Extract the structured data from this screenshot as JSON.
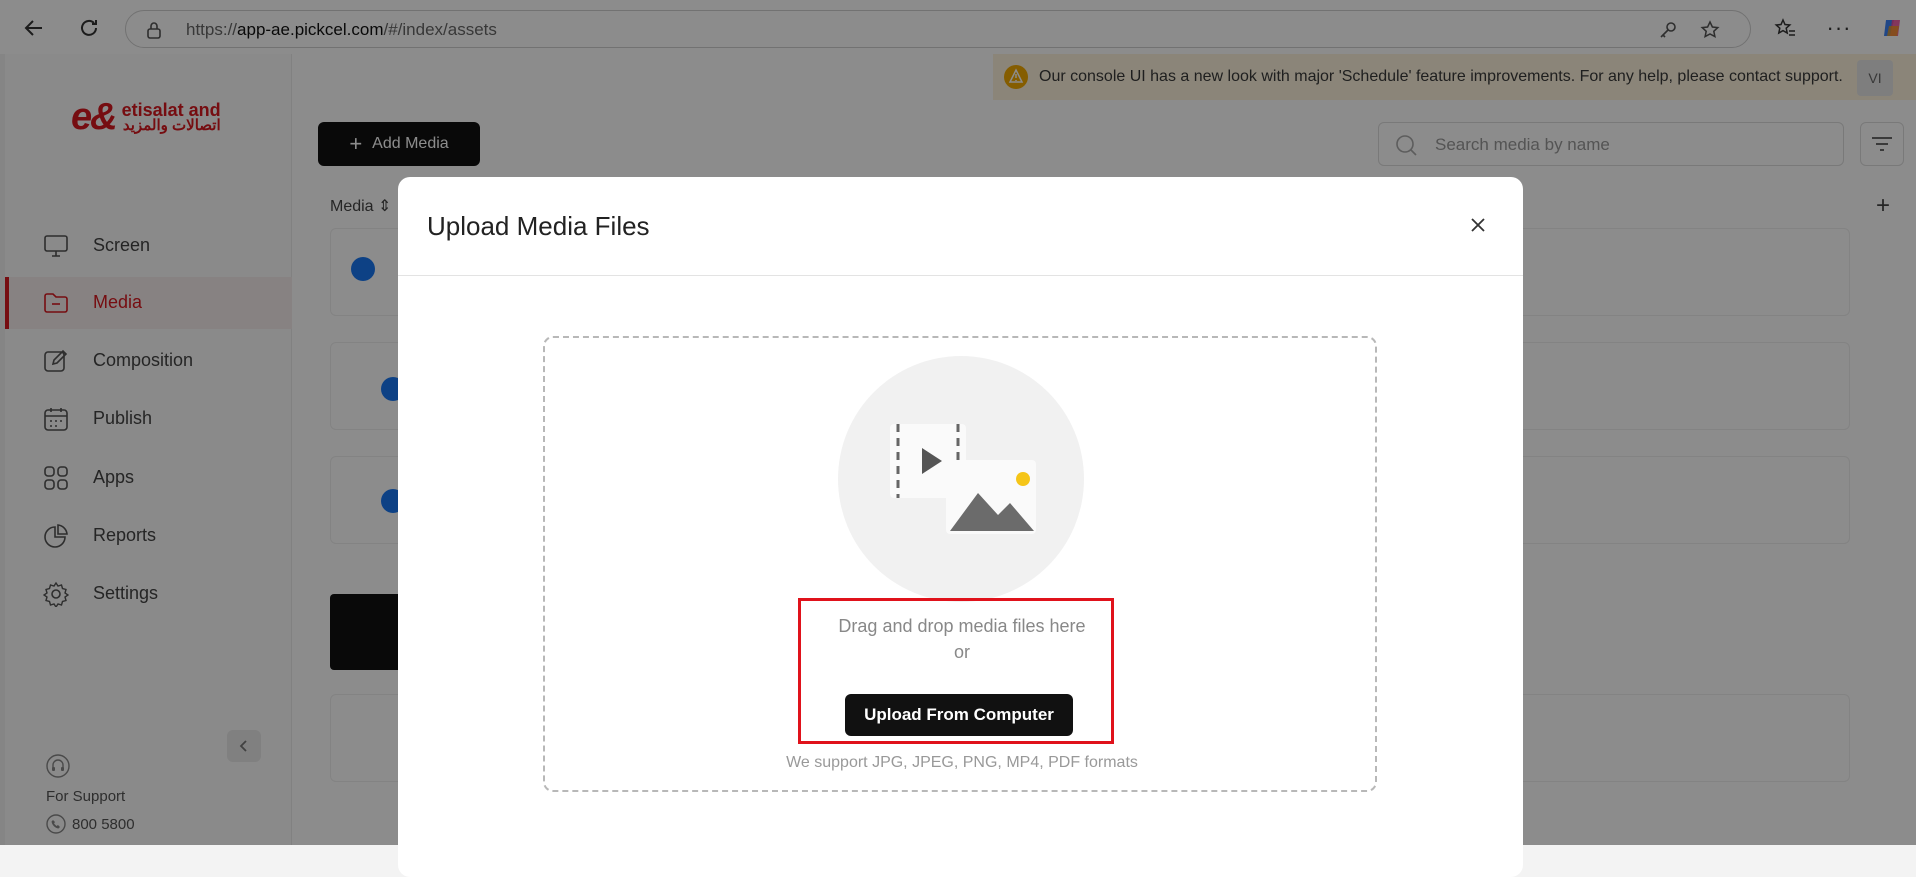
{
  "browser": {
    "url_prefix": "https://",
    "url_domain": "app-ae.pickcel.com",
    "url_path": "/#/index/assets"
  },
  "sidebar": {
    "logo_en": "etisalat and",
    "logo_ar": "اتصالات والمزيد",
    "items": [
      {
        "label": "Screen"
      },
      {
        "label": "Media"
      },
      {
        "label": "Composition"
      },
      {
        "label": "Publish"
      },
      {
        "label": "Apps"
      },
      {
        "label": "Reports"
      },
      {
        "label": "Settings"
      }
    ],
    "support_label": "For Support",
    "support_phone": "800 5800"
  },
  "main": {
    "notice": "Our console UI has a new look with major 'Schedule' feature improvements. For any help, please contact support.",
    "avatar": "VI",
    "add_media_label": "Add Media",
    "search_placeholder": "Search media by name",
    "column_media": "Media"
  },
  "modal": {
    "title": "Upload Media Files",
    "drag_text": "Drag and drop media files here",
    "or_text": "or",
    "upload_button": "Upload From Computer",
    "formats_text": "We support JPG, JPEG, PNG, MP4, PDF formats"
  },
  "colors": {
    "brand_red": "#d71920",
    "highlight_red": "#e0121b",
    "button_black": "#111111"
  }
}
